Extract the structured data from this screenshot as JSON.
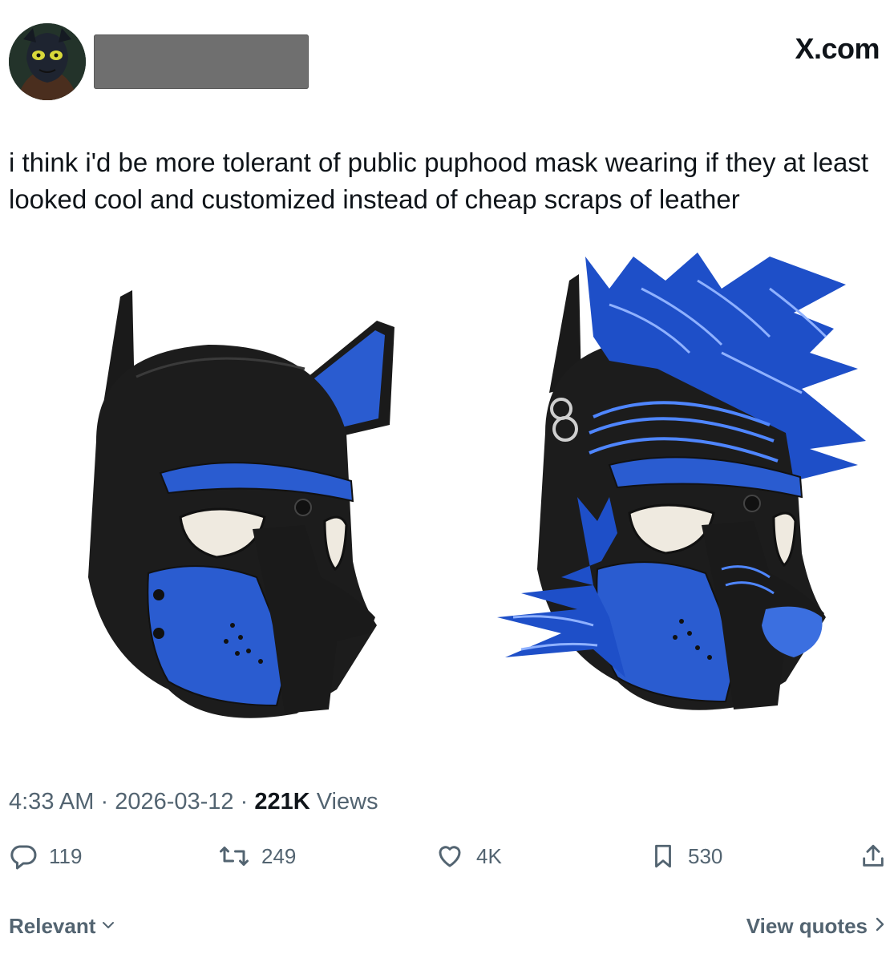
{
  "header": {
    "brand": "X.com"
  },
  "tweet": {
    "text": "i think i'd be more tolerant of public puphood mask wearing if they at least looked cool and customized instead of cheap scraps of leather",
    "time": "4:33 AM",
    "date": "2026-03-12",
    "views_count": "221K",
    "views_label": "Views",
    "separator": "·"
  },
  "actions": {
    "replies": "119",
    "reposts": "249",
    "likes": "4K",
    "bookmarks": "530"
  },
  "footer": {
    "sort_label": "Relevant",
    "quotes_label": "View quotes"
  },
  "colors": {
    "text_primary": "#0f1419",
    "text_secondary": "#536471",
    "mask_blue": "#1f4fbf",
    "mask_black": "#1a1a1a"
  }
}
